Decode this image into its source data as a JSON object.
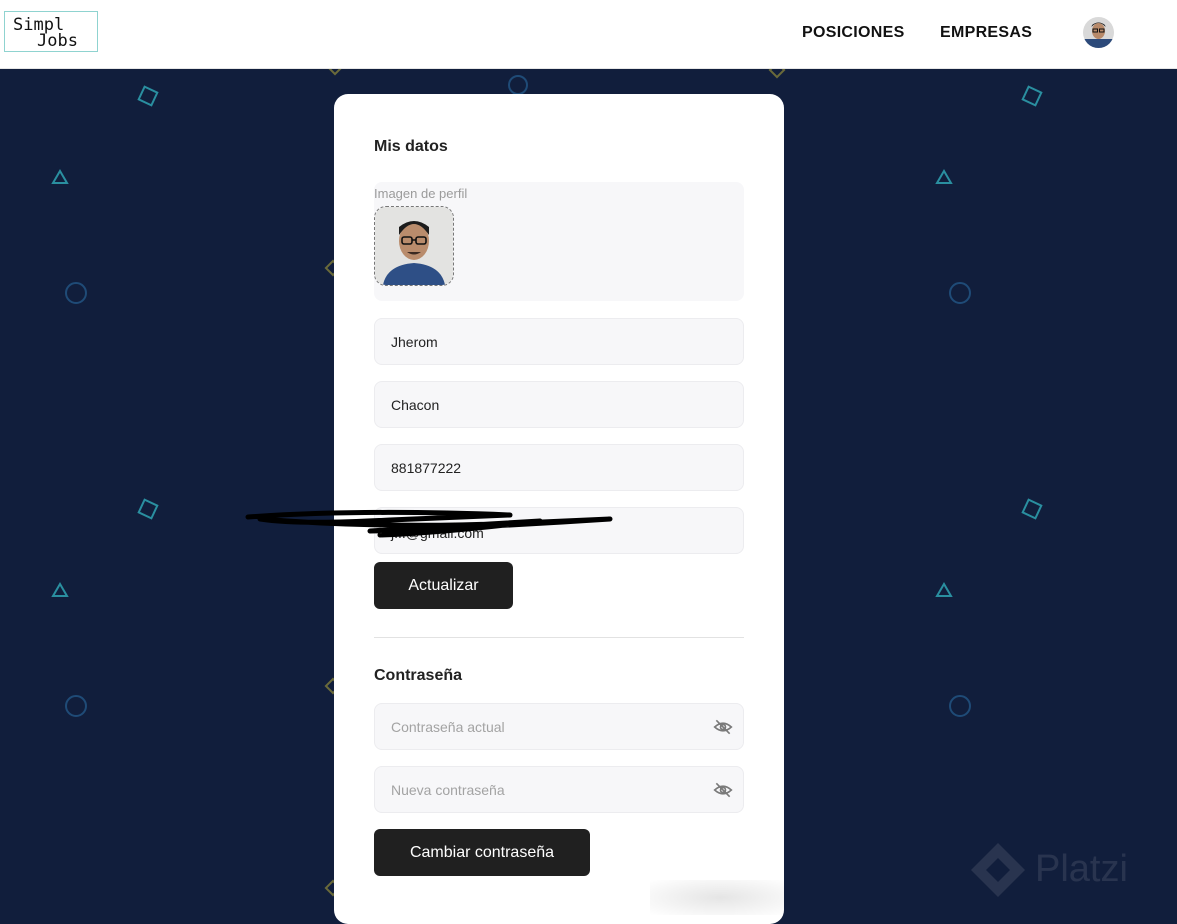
{
  "navbar": {
    "logo_line1": "Simpl",
    "logo_line2": "Jobs",
    "links": [
      "POSICIONES",
      "EMPRESAS"
    ]
  },
  "profile": {
    "title": "Mis datos",
    "image_label": "Imagen de perfil",
    "first_name": "Jherom",
    "last_name": "Chacon",
    "phone": "881877222",
    "email": "j...@gmail.com",
    "update_label": "Actualizar"
  },
  "password": {
    "title": "Contraseña",
    "current_placeholder": "Contraseña actual",
    "new_placeholder": "Nueva contraseña",
    "change_label": "Cambiar contraseña"
  },
  "watermark": "Platzi",
  "colors": {
    "background": "#111e3c",
    "shape_teal": "#2a8fa0",
    "button": "#202020"
  },
  "icons": {
    "password_toggle": "eye-off-icon"
  }
}
